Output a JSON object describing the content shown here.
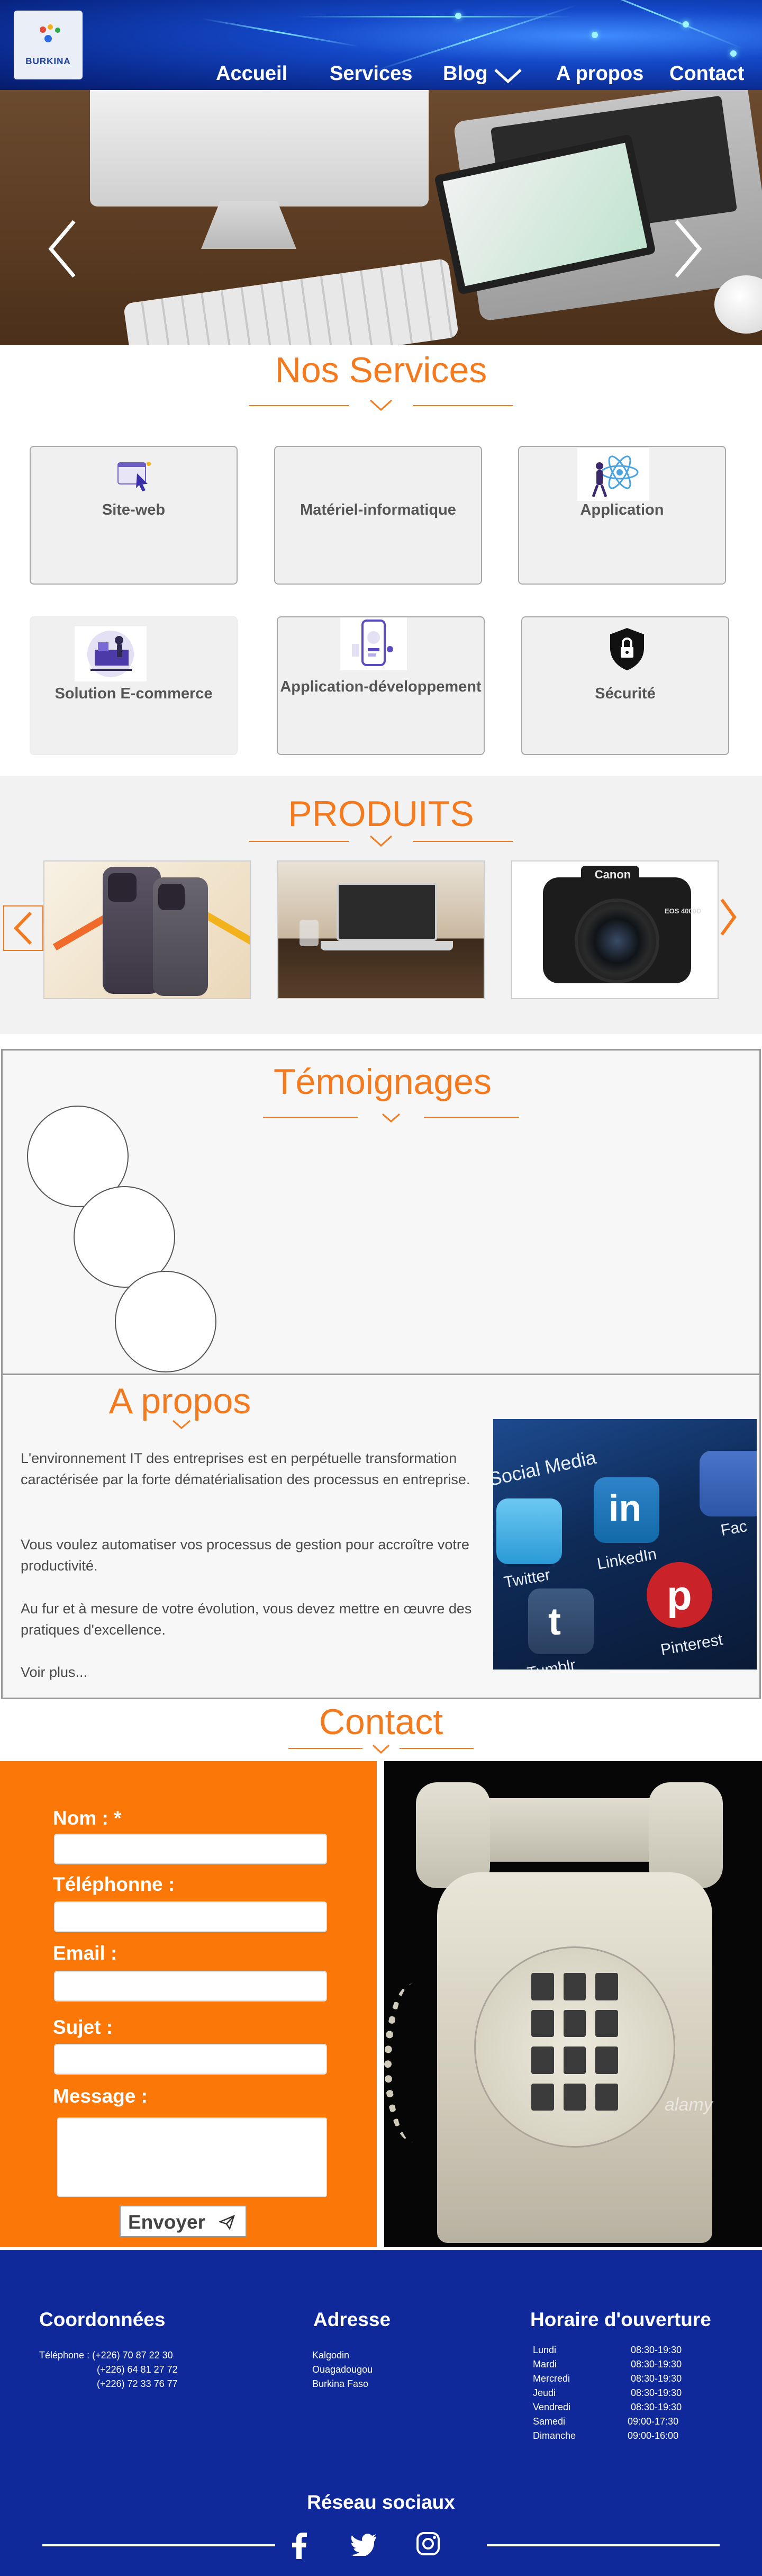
{
  "header": {
    "logo_text": "BURKINA",
    "nav": [
      {
        "label": "Accueil"
      },
      {
        "label": "Services"
      },
      {
        "label": "Blog"
      },
      {
        "label": "A propos"
      },
      {
        "label": "Contact"
      }
    ]
  },
  "hero": {
    "prev_icon": "chevron-left-icon",
    "next_icon": "chevron-right-icon"
  },
  "services": {
    "title": "Nos Services",
    "items": [
      {
        "label": "Site-web",
        "icon": "web-cursor-icon"
      },
      {
        "label": "Matériel-informatique",
        "icon": ""
      },
      {
        "label": "Application",
        "icon": "atom-person-icon"
      },
      {
        "label": "Solution E-commerce",
        "icon": "ecommerce-icon"
      },
      {
        "label": "Application-développement",
        "icon": "mobile-app-icon"
      },
      {
        "label": "Sécurité",
        "icon": "lock-shield-icon"
      }
    ]
  },
  "produits": {
    "title": "PRODUITS",
    "items": [
      {
        "image": "iphone-photo"
      },
      {
        "image": "laptop-photo"
      },
      {
        "image": "camera-photo",
        "brand": "Canon",
        "model": "EOS 4000D"
      }
    ]
  },
  "temoignages": {
    "title": "Témoignages"
  },
  "apropos": {
    "title": "A propos",
    "paragraphs": [
      "L'environnement IT des entreprises est en perpétuelle transformation caractérisée par la forte dématérialisation des processus en entreprise.",
      "Vous voulez automatiser vos processus de gestion pour accroître votre productivité.",
      "Au fur et à mesure de votre évolution, vous devez mettre en œuvre des pratiques d'excellence."
    ],
    "more": "Voir plus...",
    "image_labels": [
      "Social Media",
      "Twitter",
      "LinkedIn",
      "Fac",
      "Tumblr",
      "Pinterest"
    ]
  },
  "contact": {
    "title": "Contact",
    "fields": {
      "nom": "Nom : *",
      "telephone": "Téléphonne :",
      "email": "Email :",
      "sujet": "Sujet :",
      "message": "Message :"
    },
    "values": {
      "nom": "",
      "telephone": "",
      "email": "",
      "sujet": "",
      "message": ""
    },
    "send_label": "Envoyer",
    "photo_watermark": "alamy"
  },
  "footer": {
    "coord_title": "Coordonnées",
    "phones": [
      "Téléphone : (+226) 70 87 22 30",
      "(+226) 64 81 27 72",
      "(+226) 72 33 76 77"
    ],
    "adresse_title": "Adresse",
    "adresse_lines": [
      "Kalgodin",
      "Ouagadougou",
      "Burkina Faso"
    ],
    "horaire_title": "Horaire d'ouverture",
    "horaires": [
      {
        "day": "Lundi",
        "hours": "08:30-19:30"
      },
      {
        "day": "Mardi",
        "hours": "08:30-19:30"
      },
      {
        "day": "Mercredi",
        "hours": "08:30-19:30"
      },
      {
        "day": "Jeudi",
        "hours": "08:30-19:30"
      },
      {
        "day": "Vendredi",
        "hours": "08:30-19:30"
      },
      {
        "day": "Samedi",
        "hours": "09:00-17:30"
      },
      {
        "day": "Dimanche",
        "hours": "09:00-16:00"
      }
    ],
    "social_title": "Réseau sociaux",
    "social": [
      {
        "icon": "facebook-icon"
      },
      {
        "icon": "twitter-icon"
      },
      {
        "icon": "instagram-icon"
      }
    ]
  },
  "colors": {
    "accent": "#f47a1f",
    "form_bg": "#fb7707",
    "footer_bg": "#10299a",
    "header_bg": "#1448c8"
  }
}
